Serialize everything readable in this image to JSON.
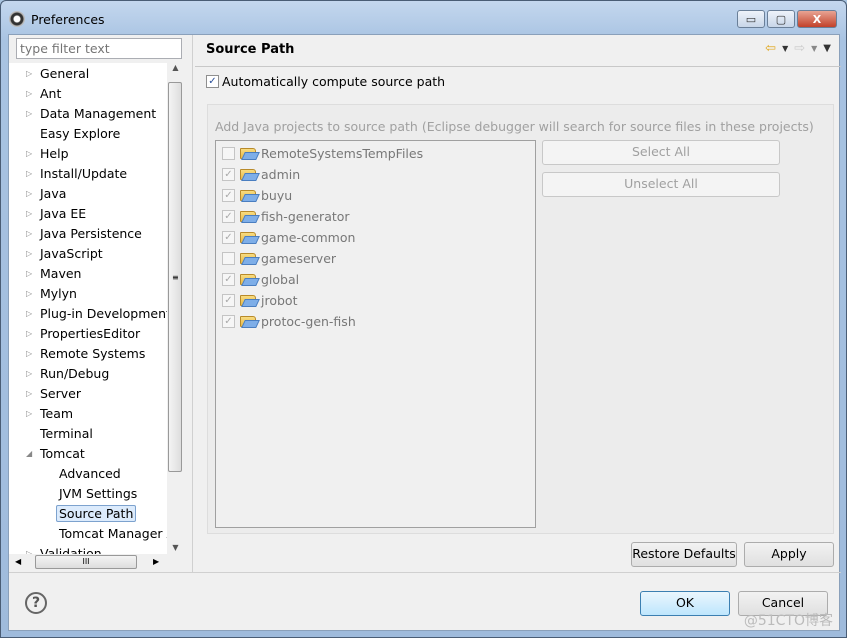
{
  "window": {
    "title": "Preferences",
    "minimize": "▭",
    "maximize": "▢",
    "close": "X"
  },
  "sidebar": {
    "filter_placeholder": "type filter text",
    "items": [
      {
        "label": "General",
        "arrow": "▷",
        "level": 0
      },
      {
        "label": "Ant",
        "arrow": "▷",
        "level": 0
      },
      {
        "label": "Data Management",
        "arrow": "▷",
        "level": 0
      },
      {
        "label": "Easy Explore",
        "arrow": "",
        "level": 0
      },
      {
        "label": "Help",
        "arrow": "▷",
        "level": 0
      },
      {
        "label": "Install/Update",
        "arrow": "▷",
        "level": 0
      },
      {
        "label": "Java",
        "arrow": "▷",
        "level": 0
      },
      {
        "label": "Java EE",
        "arrow": "▷",
        "level": 0
      },
      {
        "label": "Java Persistence",
        "arrow": "▷",
        "level": 0
      },
      {
        "label": "JavaScript",
        "arrow": "▷",
        "level": 0
      },
      {
        "label": "Maven",
        "arrow": "▷",
        "level": 0
      },
      {
        "label": "Mylyn",
        "arrow": "▷",
        "level": 0
      },
      {
        "label": "Plug-in Development",
        "arrow": "▷",
        "level": 0
      },
      {
        "label": "PropertiesEditor",
        "arrow": "▷",
        "level": 0
      },
      {
        "label": "Remote Systems",
        "arrow": "▷",
        "level": 0
      },
      {
        "label": "Run/Debug",
        "arrow": "▷",
        "level": 0
      },
      {
        "label": "Server",
        "arrow": "▷",
        "level": 0
      },
      {
        "label": "Team",
        "arrow": "▷",
        "level": 0
      },
      {
        "label": "Terminal",
        "arrow": "",
        "level": 0
      },
      {
        "label": "Tomcat",
        "arrow": "◢",
        "level": 0
      },
      {
        "label": "Advanced",
        "arrow": "",
        "level": 1
      },
      {
        "label": "JVM Settings",
        "arrow": "",
        "level": 1
      },
      {
        "label": "Source Path",
        "arrow": "",
        "level": 1,
        "selected": true
      },
      {
        "label": "Tomcat Manager A",
        "arrow": "",
        "level": 1
      },
      {
        "label": "Validation",
        "arrow": "▷",
        "level": 0
      }
    ]
  },
  "page": {
    "title": "Source Path",
    "auto_label": "Automatically compute source path",
    "auto_checked": true,
    "hint": "Add Java projects to source path (Eclipse debugger will search for source files in these projects)",
    "projects": [
      {
        "name": "RemoteSystemsTempFiles",
        "checked": false
      },
      {
        "name": "admin",
        "checked": true
      },
      {
        "name": "buyu",
        "checked": true
      },
      {
        "name": "fish-generator",
        "checked": true
      },
      {
        "name": "game-common",
        "checked": true
      },
      {
        "name": "gameserver",
        "checked": false
      },
      {
        "name": "global",
        "checked": true
      },
      {
        "name": "jrobot",
        "checked": true
      },
      {
        "name": "protoc-gen-fish",
        "checked": true
      }
    ],
    "select_all": "Select All",
    "unselect_all": "Unselect All",
    "restore_defaults": "Restore Defaults",
    "apply": "Apply"
  },
  "footer": {
    "ok": "OK",
    "cancel": "Cancel",
    "help": "?"
  },
  "watermark": "@51CTO博客"
}
